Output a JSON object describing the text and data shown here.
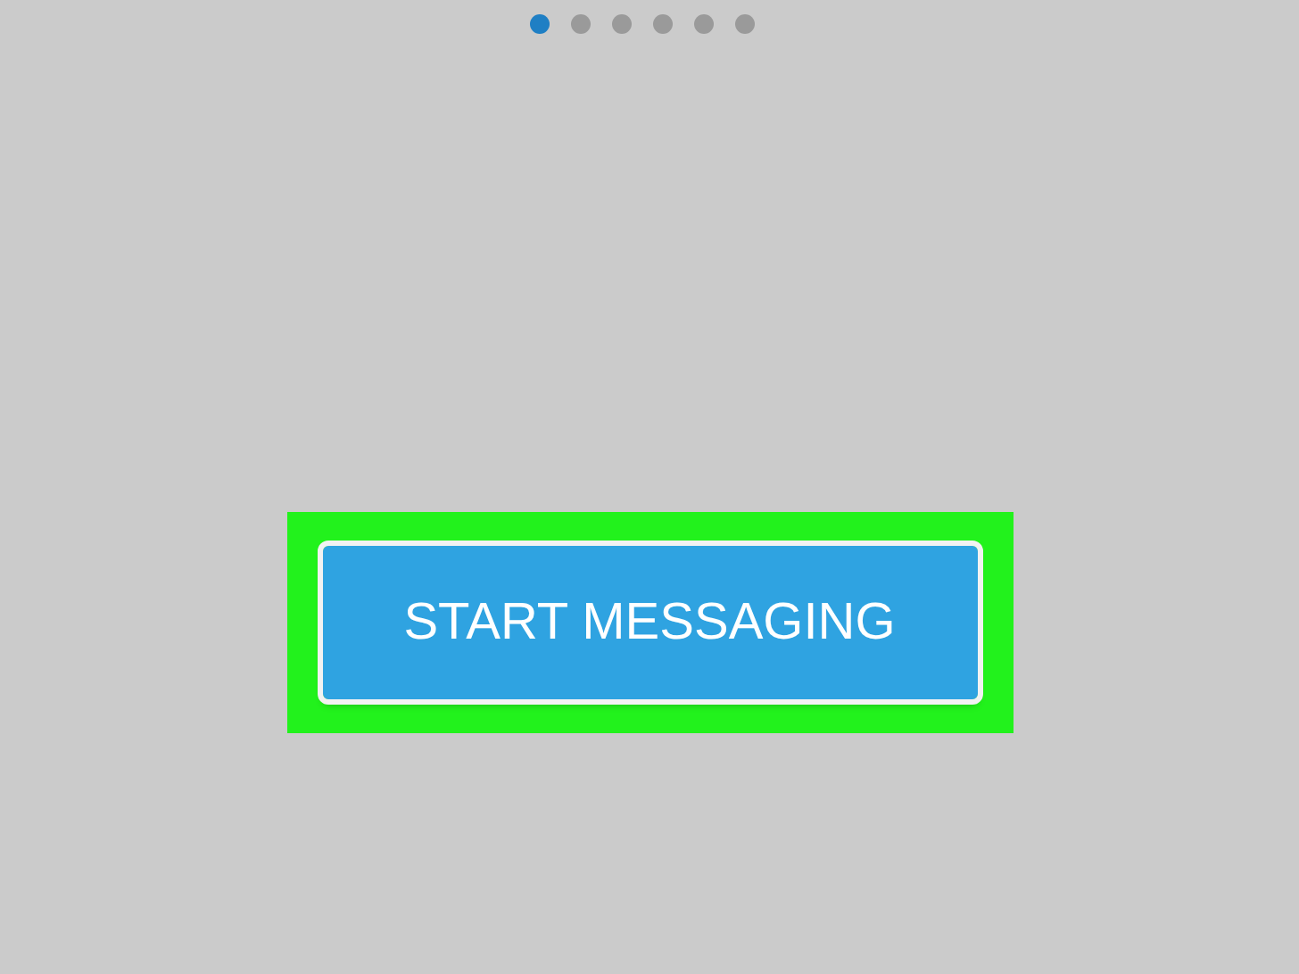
{
  "pager": {
    "dots": [
      {
        "selected": true
      },
      {
        "selected": false
      },
      {
        "selected": false
      },
      {
        "selected": false
      },
      {
        "selected": false
      },
      {
        "selected": false
      }
    ]
  },
  "start_button": {
    "label": "START MESSAGING",
    "highlighted": true
  }
}
